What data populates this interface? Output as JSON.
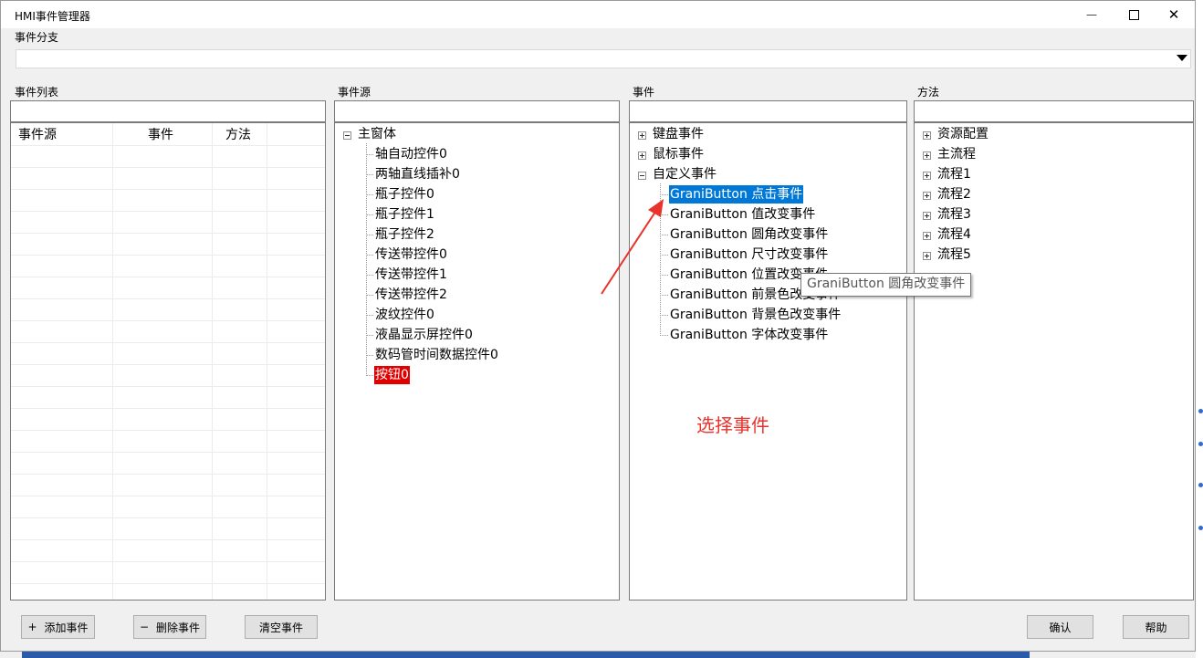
{
  "window": {
    "title": "HMI事件管理器",
    "minimize_glyph": "—",
    "maximize_glyph": "☐",
    "close_glyph": "✕"
  },
  "branch": {
    "label": "事件分支",
    "value": ""
  },
  "event_list": {
    "label": "事件列表",
    "filter_value": "",
    "columns": [
      "事件源",
      "事件",
      "方法"
    ],
    "rows": []
  },
  "source": {
    "label": "事件源",
    "filter_value": "",
    "root": "主窗体",
    "items": [
      "轴自动控件0",
      "两轴直线插补0",
      "瓶子控件0",
      "瓶子控件1",
      "瓶子控件2",
      "传送带控件0",
      "传送带控件1",
      "传送带控件2",
      "波纹控件0",
      "液晶显示屏控件0",
      "数码管时间数据控件0",
      "按钮0"
    ],
    "selected": "按钮0"
  },
  "events": {
    "label": "事件",
    "filter_value": "",
    "groups": [
      "键盘事件",
      "鼠标事件",
      "自定义事件"
    ],
    "custom_items": [
      "GraniButton 点击事件",
      "GraniButton 值改变事件",
      "GraniButton 圆角改变事件",
      "GraniButton 尺寸改变事件",
      "GraniButton 位置改变事件",
      "GraniButton 前景色改变事件",
      "GraniButton 背景色改变事件",
      "GraniButton 字体改变事件"
    ],
    "selected": "GraniButton 点击事件",
    "tooltip": "GraniButton 圆角改变事件"
  },
  "methods": {
    "label": "方法",
    "filter_value": "",
    "items": [
      "资源配置",
      "主流程",
      "流程1",
      "流程2",
      "流程3",
      "流程4",
      "流程5"
    ]
  },
  "annotation": {
    "text": "选择事件",
    "color": "#e8322b"
  },
  "buttons": {
    "add": "添加事件",
    "add_glyph": "+",
    "delete": "删除事件",
    "delete_glyph": "−",
    "clear": "清空事件",
    "confirm": "确认",
    "help": "帮助"
  },
  "colors": {
    "selection_blue": "#0078d7",
    "selection_red": "#e00000"
  }
}
